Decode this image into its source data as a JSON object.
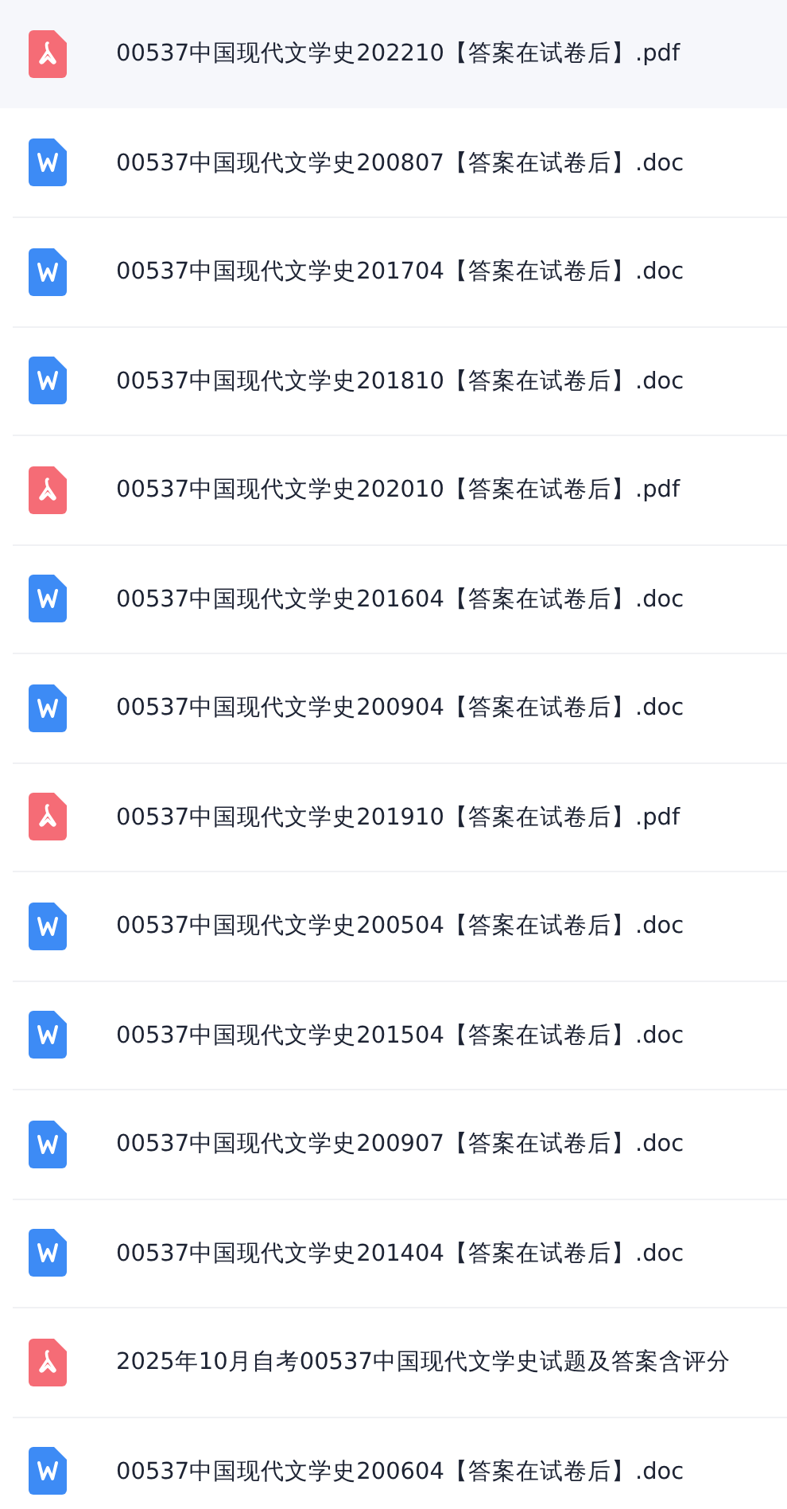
{
  "files": [
    {
      "kind": "pdf",
      "name": "00537中国现代文学史202210【答案在试卷后】.pdf",
      "selected": true
    },
    {
      "kind": "doc",
      "name": "00537中国现代文学史200807【答案在试卷后】.doc",
      "selected": false
    },
    {
      "kind": "doc",
      "name": "00537中国现代文学史201704【答案在试卷后】.doc",
      "selected": false
    },
    {
      "kind": "doc",
      "name": "00537中国现代文学史201810【答案在试卷后】.doc",
      "selected": false
    },
    {
      "kind": "pdf",
      "name": "00537中国现代文学史202010【答案在试卷后】.pdf",
      "selected": false
    },
    {
      "kind": "doc",
      "name": "00537中国现代文学史201604【答案在试卷后】.doc",
      "selected": false
    },
    {
      "kind": "doc",
      "name": "00537中国现代文学史200904【答案在试卷后】.doc",
      "selected": false
    },
    {
      "kind": "pdf",
      "name": "00537中国现代文学史201910【答案在试卷后】.pdf",
      "selected": false
    },
    {
      "kind": "doc",
      "name": "00537中国现代文学史200504【答案在试卷后】.doc",
      "selected": false
    },
    {
      "kind": "doc",
      "name": "00537中国现代文学史201504【答案在试卷后】.doc",
      "selected": false
    },
    {
      "kind": "doc",
      "name": "00537中国现代文学史200907【答案在试卷后】.doc",
      "selected": false
    },
    {
      "kind": "doc",
      "name": "00537中国现代文学史201404【答案在试卷后】.doc",
      "selected": false
    },
    {
      "kind": "pdf",
      "name": "2025年10月自考00537中国现代文学史试题及答案含评分",
      "selected": false
    },
    {
      "kind": "doc",
      "name": "00537中国现代文学史200604【答案在试卷后】.doc",
      "selected": false
    }
  ]
}
